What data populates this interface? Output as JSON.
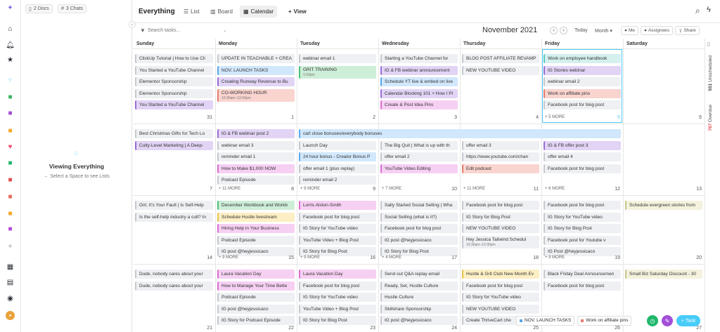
{
  "sidebar": {
    "docs_chip": "2 Docs",
    "chats_chip": "3 Chats",
    "viewing_title": "Viewing Everything",
    "viewing_sub": "Select a Space to see Lists"
  },
  "header": {
    "title": "Everything",
    "tabs": [
      {
        "label": "List"
      },
      {
        "label": "Board"
      },
      {
        "label": "Calendar"
      }
    ],
    "add_view": "View"
  },
  "toolbar": {
    "search_placeholder": "Search tasks...",
    "month_label": "November 2021",
    "today_label": "Today",
    "range_label": "Month",
    "me_label": "Me",
    "assignees_label": "Assignees",
    "share_label": "Share"
  },
  "days": [
    "Sunday",
    "Monday",
    "Tuesday",
    "Wednesday",
    "Thursday",
    "Friday",
    "Saturday"
  ],
  "weeks": [
    {
      "nums": [
        "31",
        "1",
        "2",
        "3",
        "4",
        "5",
        "6"
      ],
      "more": [
        "",
        "",
        "",
        "",
        "",
        "+ 5 MORE",
        ""
      ],
      "cells": [
        [
          {
            "t": "ClickUp Tutorial | How to Use Cli",
            "c": "light"
          },
          {
            "t": "You Started a YouTube Channel",
            "c": "light"
          },
          {
            "t": "Elementor Sponsorship",
            "c": "light"
          },
          {
            "t": "Elementor Sponsorship",
            "c": "light"
          },
          {
            "t": "You Started a YouTube Channel",
            "c": "purple"
          }
        ],
        [
          {
            "t": "UPDATE IN TEACHABLE + CREA",
            "c": "light"
          },
          {
            "t": "NOV. LAUNCH TASKS",
            "c": "blue"
          },
          {
            "t": "Creating Runway Revenue to Bu",
            "c": "purple"
          },
          {
            "t": "CO-WORKING HOUR",
            "c": "red",
            "sub": "10:30am–12:00pm"
          }
        ],
        [
          {
            "t": "webinar email 1",
            "c": "light"
          },
          {
            "t": "GRIT TRAINING",
            "c": "green",
            "sub": "1:00pm"
          }
        ],
        [
          {
            "t": "Starting a YouTube Channel for",
            "c": "light"
          },
          {
            "t": "IG & FB webinar announcement",
            "c": "purple"
          },
          {
            "t": "Schedule YT live & embed on live",
            "c": "blue"
          },
          {
            "t": "Calendar Blocking 101 + How I Pl",
            "c": "purple"
          },
          {
            "t": "Create & Post Idea Pins",
            "c": "pink"
          }
        ],
        [
          {
            "t": "BLOG POST AFFILIATE REVAMP",
            "c": "light"
          },
          {
            "t": "NEW YOUTUBE VIDEO",
            "c": "light"
          }
        ],
        [
          {
            "t": "Work on employee handbook",
            "c": "teal"
          },
          {
            "t": "IG Stories webinar",
            "c": "purple"
          },
          {
            "t": "webinar email 2",
            "c": "light"
          },
          {
            "t": "Work on affiliate pins",
            "c": "red"
          },
          {
            "t": "Facebook post for blog post",
            "c": "light"
          }
        ],
        []
      ]
    },
    {
      "nums": [
        "7",
        "8",
        "9",
        "10",
        "11",
        "12",
        "13"
      ],
      "more": [
        "",
        "+ 11 MORE",
        "+ 9 MORE",
        "+ 7 MORE",
        "+ 11 MORE",
        "+ 6 MORE",
        ""
      ],
      "cells": [
        [
          {
            "t": "Best Christmas Gifts for Tech Lo",
            "c": "light"
          },
          {
            "t": "Culty-Level Marketing | A Deep-",
            "c": "purple"
          }
        ],
        [
          {
            "t": "IG & FB webinar post 2",
            "c": "purple"
          },
          {
            "t": "webinar email 3",
            "c": "light"
          },
          {
            "t": "reminder email 1",
            "c": "light"
          },
          {
            "t": "How to Make $1,000 NOW",
            "c": "pink"
          },
          {
            "t": "Podcast Episode",
            "c": "light"
          }
        ],
        [
          {
            "t": "",
            "c": "none"
          },
          {
            "t": "Launch Day",
            "c": "light"
          },
          {
            "t": "24 hour bonus - Creator Bonus P",
            "c": "blue"
          },
          {
            "t": "offer email 1 (plus replay)",
            "c": "light"
          },
          {
            "t": "reminder email 2",
            "c": "light"
          }
        ],
        [
          {
            "t": "IG & FB offer post 1",
            "c": "purple"
          },
          {
            "t": "The Big Quit | What is up with th",
            "c": "light"
          },
          {
            "t": "offer email 2",
            "c": "light"
          },
          {
            "t": "YouTube Video Editing",
            "c": "pink"
          }
        ],
        [
          {
            "t": "SPONSOR SPOT",
            "c": "light"
          },
          {
            "t": "offer email 3",
            "c": "light"
          },
          {
            "t": "https://www.youtube.com/chan",
            "c": "light"
          },
          {
            "t": "Edit podcast",
            "c": "red"
          }
        ],
        [
          {
            "t": "DOORS CLOSE @ MIDNIGHT",
            "c": "yellow"
          },
          {
            "t": "IG & FB offer post 3",
            "c": "purple"
          },
          {
            "t": "offer email 4",
            "c": "light"
          },
          {
            "t": "Facebook post for blog post",
            "c": "light"
          }
        ],
        []
      ]
    },
    {
      "nums": [
        "14",
        "15",
        "16",
        "17",
        "18",
        "19",
        "20"
      ],
      "more": [
        "",
        "+ 9 MORE",
        "+ 9 MORE",
        "+ 4 MORE",
        "",
        "+ 9 MORE",
        ""
      ],
      "cells": [
        [
          {
            "t": "Girl, It's Your Fault | Is Self-Help",
            "c": "light"
          },
          {
            "t": "Is the self-help industry a cult? In",
            "c": "light"
          }
        ],
        [
          {
            "t": "December Workbook and Workb",
            "c": "green"
          },
          {
            "t": "Schedule Hustle livestream",
            "c": "yellow"
          },
          {
            "t": "Hiring Help in Your Business",
            "c": "pink"
          },
          {
            "t": "Podcast Episode",
            "c": "light"
          },
          {
            "t": "IG post @heyjessicaco",
            "c": "light"
          }
        ],
        [
          {
            "t": "Lorris Alston-Smith",
            "c": "pink"
          },
          {
            "t": "Facebook post for blog post",
            "c": "light"
          },
          {
            "t": "IG Story for YouTube video",
            "c": "light"
          },
          {
            "t": "YouTube Video + Blog Post",
            "c": "light"
          },
          {
            "t": "IG Story for Blog Post",
            "c": "light"
          }
        ],
        [
          {
            "t": "Sally Started Social Selling | Wha",
            "c": "light"
          },
          {
            "t": "Social Selling (what is it?)",
            "c": "light"
          },
          {
            "t": "Facebook post for blog post",
            "c": "light"
          },
          {
            "t": "IG post @heyjessicaco",
            "c": "light"
          },
          {
            "t": "IG Story for Blog Post",
            "c": "light"
          }
        ],
        [
          {
            "t": "Facebook post for blog post",
            "c": "light"
          },
          {
            "t": "IG Story for Blog Post",
            "c": "light"
          },
          {
            "t": "NEW YOUTUBE VIDEO",
            "c": "light"
          },
          {
            "t": "Hey Jessica Tailwind Schedul",
            "c": "light",
            "sub": "10:30am–12:00pm"
          }
        ],
        [
          {
            "t": "Facebook post for blog post",
            "c": "light"
          },
          {
            "t": "IG Story for YouTube video",
            "c": "light"
          },
          {
            "t": "IG Story for Blog Post",
            "c": "light"
          },
          {
            "t": "Facebook post for Youtube v",
            "c": "light"
          },
          {
            "t": "IG Post @heyjessicaco",
            "c": "light"
          }
        ],
        [
          {
            "t": "Schedule evergreen stories from",
            "c": "olive"
          }
        ]
      ]
    },
    {
      "nums": [
        "21",
        "22",
        "23",
        "24",
        "25",
        "26",
        "27"
      ],
      "more": [
        "",
        "",
        "",
        "",
        "",
        "",
        ""
      ],
      "cells": [
        [
          {
            "t": "Dude, nobody cares about your",
            "c": "light"
          },
          {
            "t": "Dude, nobody cares about your",
            "c": "light"
          }
        ],
        [
          {
            "t": "Laura Vacation Day",
            "c": "pink"
          },
          {
            "t": "How to Manage Your Time Bette",
            "c": "pink"
          },
          {
            "t": "Podcast Episode",
            "c": "light"
          },
          {
            "t": "IG post @heyjessicaco",
            "c": "light"
          },
          {
            "t": "IG Story for Podcast Episode",
            "c": "light"
          }
        ],
        [
          {
            "t": "Laura Vacation Day",
            "c": "pink"
          },
          {
            "t": "Facebook post for blog post",
            "c": "light"
          },
          {
            "t": "IG Story for YouTube video",
            "c": "light"
          },
          {
            "t": "YouTube Video + Blog Post",
            "c": "light"
          },
          {
            "t": "IG Story for Blog Post",
            "c": "light"
          }
        ],
        [
          {
            "t": "Send out Q&A replay email",
            "c": "light"
          },
          {
            "t": "Ready, Set, Hustle Culture",
            "c": "light"
          },
          {
            "t": "Hustle Culture",
            "c": "light"
          },
          {
            "t": "Skillshare Sponsorship",
            "c": "light"
          },
          {
            "t": "IG post @heyjessicaco",
            "c": "light"
          }
        ],
        [
          {
            "t": "Hustle & Grit Club New Month Ev",
            "c": "yellow"
          },
          {
            "t": "Facebook post for blog post",
            "c": "light"
          },
          {
            "t": "IG Story for YouTube video",
            "c": "light"
          },
          {
            "t": "NEW YOUTUBE VIDEO",
            "c": "light"
          },
          {
            "t": "Create ThriveCart che",
            "c": "light"
          }
        ],
        [
          {
            "t": "Black Friday Deal Announcemen",
            "c": "light"
          },
          {
            "t": "Facebook post for blog post",
            "c": "light"
          },
          {
            "t": "",
            "c": "none"
          },
          {
            "t": "",
            "c": "none"
          },
          {
            "t": "",
            "c": "none"
          }
        ],
        [
          {
            "t": "Small Biz Saturday Discount - 30",
            "c": "olive"
          }
        ]
      ]
    }
  ],
  "banner": "cart close bonuses/everybody bonuses",
  "right_panel": {
    "unscheduled_count": "551",
    "unscheduled_label": "Unscheduled",
    "overdue_count": "767",
    "overdue_label": "Overdue"
  },
  "trays": [
    {
      "label": "NOV. LAUNCH TASKS",
      "color": "#5aa7e8"
    },
    {
      "label": "Work on affiliate pins",
      "color": "#e57c6d"
    }
  ],
  "task_button": "Task"
}
